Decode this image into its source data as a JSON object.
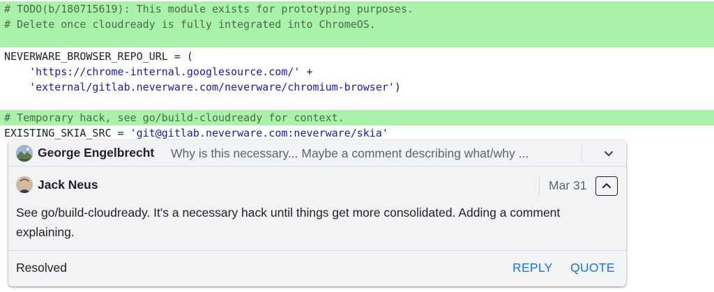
{
  "code": {
    "lines": [
      {
        "kind": "comment",
        "text": "# TODO(b/180715619): This module exists for prototyping purposes."
      },
      {
        "kind": "comment",
        "text": "# Delete once cloudready is fully integrated into ChromeOS."
      },
      {
        "kind": "plain",
        "text": "NEVERWARE_BROWSER_REPO_URL = ("
      },
      {
        "prefix": "    ",
        "string": "'https://chrome-internal.googlesource.com/'",
        "suffix": " +"
      },
      {
        "prefix": "    ",
        "string": "'external/gitlab.neverware.com/neverware/chromium-browser'",
        "suffix": ")"
      },
      {
        "kind": "comment",
        "text": "# Temporary hack, see go/build-cloudready for context."
      },
      {
        "prefix": "EXISTING_SKIA_SRC = ",
        "string": "'git@gitlab.neverware.com:neverware/skia'",
        "suffix": ""
      }
    ]
  },
  "thread": {
    "collapsed_comment": {
      "author": "George Engelbrecht",
      "preview": "Why is this necessary... Maybe a comment describing what/why ..."
    },
    "expanded_comment": {
      "author": "Jack Neus",
      "date": "Mar 31",
      "body": "See go/build-cloudready. It's a necessary hack until things get more consolidated. Adding a comment explaining."
    },
    "footer": {
      "status": "Resolved",
      "reply_label": "REPLY",
      "quote_label": "QUOTE"
    }
  },
  "colors": {
    "added_line_bg": "#aaf2aa",
    "string": "#1a1aa6",
    "link_blue": "#1a73e8",
    "card_bg": "#f1f3f4"
  },
  "icons": [
    "avatar-george",
    "avatar-jack",
    "chevron-down-icon",
    "chevron-up-icon"
  ]
}
